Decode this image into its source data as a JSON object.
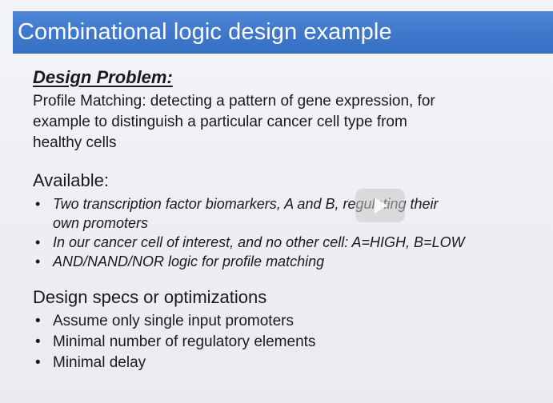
{
  "title": "Combinational logic design example",
  "design_problem": {
    "heading": "Design Problem:",
    "lines": [
      "Profile Matching: detecting a pattern of gene expression, for",
      "example to distinguish a particular cancer cell type from",
      "healthy cells"
    ]
  },
  "available": {
    "heading": "Available:",
    "items": [
      {
        "line1": "Two transcription factor biomarkers, A and B, regulating their",
        "line2": "own promoters"
      },
      {
        "line1": "In our cancer cell of interest, and no other cell: A=HIGH, B=LOW",
        "line2": ""
      },
      {
        "line1": "AND/NAND/NOR logic for profile matching",
        "line2": ""
      }
    ]
  },
  "specs": {
    "heading": "Design specs or optimizations",
    "items": [
      "Assume only single input promoters",
      "Minimal number of regulatory elements",
      "Minimal delay"
    ]
  },
  "bullet_glyph": "•",
  "icons": {
    "video_overlay": "play-icon"
  },
  "colors": {
    "title_bar": "#3f78cb",
    "title_text": "#ffffff",
    "body_text": "#1a1a1a"
  }
}
